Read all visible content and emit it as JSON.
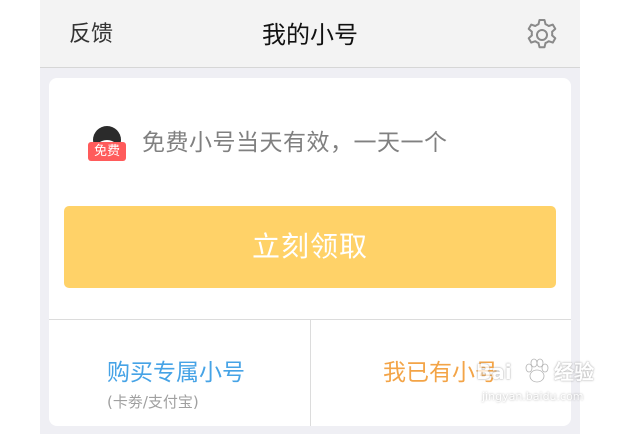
{
  "navbar": {
    "left_label": "反馈",
    "title": "我的小号",
    "settings_icon": "gear-icon"
  },
  "promo": {
    "badge": "免费",
    "icon": "avatar-icon",
    "text": "免费小号当天有效，一天一个"
  },
  "claim_button": {
    "label": "立刻领取",
    "color": "#ffd268"
  },
  "options": {
    "buy": {
      "label": "购买专属小号",
      "sub": "(卡劵/支付宝)",
      "color": "#46a3e6"
    },
    "have": {
      "label": "我已有小号",
      "color": "#f3a447"
    }
  },
  "watermark": {
    "brand_prefix": "Bai",
    "brand_suffix": "经验",
    "url": "jingyan.baidu.com"
  }
}
